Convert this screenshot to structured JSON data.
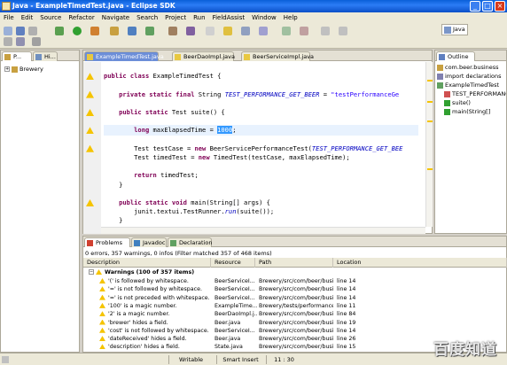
{
  "window": {
    "title": "Java - ExampleTimedTest.java - Eclipse SDK"
  },
  "menu": [
    "File",
    "Edit",
    "Source",
    "Refactor",
    "Navigate",
    "Search",
    "Project",
    "Run",
    "FieldAssist",
    "Window",
    "Help"
  ],
  "perspective": {
    "label": "Java"
  },
  "left_panel": {
    "tabs": [
      "P...",
      "Hi..."
    ],
    "tree": [
      {
        "label": "Brewery"
      }
    ]
  },
  "editor": {
    "tabs": [
      "ExampleTimedTest.java",
      "BeerDaoImpl.java",
      "BeerServiceImpl.java"
    ],
    "lines": [
      {
        "highlight": false,
        "warn": false,
        "html_parts": [
          {
            "t": "",
            "c": ""
          }
        ]
      },
      {
        "highlight": false,
        "warn": true,
        "parts": [
          {
            "t": "public ",
            "c": "kw"
          },
          {
            "t": "class ",
            "c": "kw"
          },
          {
            "t": "ExampleTimedTest {",
            "c": ""
          }
        ]
      },
      {
        "highlight": false,
        "warn": false,
        "parts": []
      },
      {
        "highlight": false,
        "warn": true,
        "parts": [
          {
            "t": "    private static final ",
            "c": "kw"
          },
          {
            "t": "String ",
            "c": ""
          },
          {
            "t": "TEST_PERFORMANCE_GET_BEER",
            "c": "fld"
          },
          {
            "t": " = ",
            "c": ""
          },
          {
            "t": "\"testPerformanceGe",
            "c": "str"
          }
        ]
      },
      {
        "highlight": false,
        "warn": false,
        "parts": []
      },
      {
        "highlight": false,
        "warn": true,
        "parts": [
          {
            "t": "    public static ",
            "c": "kw"
          },
          {
            "t": "Test suite() {",
            "c": ""
          }
        ]
      },
      {
        "highlight": false,
        "warn": false,
        "parts": []
      },
      {
        "highlight": true,
        "warn": true,
        "parts": [
          {
            "t": "        long ",
            "c": "kw"
          },
          {
            "t": "maxElapsedTime = ",
            "c": ""
          },
          {
            "t": "1000",
            "c": "sel"
          },
          {
            "t": ";",
            "c": ""
          }
        ]
      },
      {
        "highlight": false,
        "warn": false,
        "parts": []
      },
      {
        "highlight": false,
        "warn": true,
        "parts": [
          {
            "t": "        Test testCase = ",
            "c": ""
          },
          {
            "t": "new ",
            "c": "kw"
          },
          {
            "t": "BeerServicePerformanceTest(",
            "c": ""
          },
          {
            "t": "TEST_PERFORMANCE_GET_BEE",
            "c": "fld"
          }
        ]
      },
      {
        "highlight": false,
        "warn": false,
        "parts": [
          {
            "t": "        Test timedTest = ",
            "c": ""
          },
          {
            "t": "new ",
            "c": "kw"
          },
          {
            "t": "TimedTest(testCase, maxElapsedTime);",
            "c": ""
          }
        ]
      },
      {
        "highlight": false,
        "warn": false,
        "parts": []
      },
      {
        "highlight": false,
        "warn": false,
        "parts": [
          {
            "t": "        return ",
            "c": "kw"
          },
          {
            "t": "timedTest;",
            "c": ""
          }
        ]
      },
      {
        "highlight": false,
        "warn": false,
        "parts": [
          {
            "t": "    }",
            "c": ""
          }
        ]
      },
      {
        "highlight": false,
        "warn": false,
        "parts": []
      },
      {
        "highlight": false,
        "warn": true,
        "parts": [
          {
            "t": "    public static void ",
            "c": "kw"
          },
          {
            "t": "main(String[] args) {",
            "c": ""
          }
        ]
      },
      {
        "highlight": false,
        "warn": false,
        "parts": [
          {
            "t": "        junit.textui.TestRunner.",
            "c": ""
          },
          {
            "t": "run",
            "c": "fld"
          },
          {
            "t": "(suite());",
            "c": ""
          }
        ]
      },
      {
        "highlight": false,
        "warn": false,
        "parts": [
          {
            "t": "    }",
            "c": ""
          }
        ]
      },
      {
        "highlight": false,
        "warn": false,
        "parts": [
          {
            "t": "}",
            "c": ""
          }
        ]
      }
    ]
  },
  "outline": {
    "tab": "Outline",
    "items": [
      {
        "label": "com.beer.business",
        "indent": 0
      },
      {
        "label": "import declarations",
        "indent": 0
      },
      {
        "label": "ExampleTimedTest",
        "indent": 0
      },
      {
        "label": "TEST_PERFORMANCE",
        "indent": 1
      },
      {
        "label": "suite()",
        "indent": 1
      },
      {
        "label": "main(String[]",
        "indent": 1
      }
    ]
  },
  "problems": {
    "tabs": [
      "Problems",
      "Javadoc",
      "Declaration"
    ],
    "summary": "0 errors, 357 warnings, 0 infos (Filter matched 357 of 468 items)",
    "columns": [
      "Description",
      "Resource",
      "Path",
      "Location"
    ],
    "group": "Warnings (100 of 357 items)",
    "rows": [
      {
        "description": "'(' is followed by whitespace.",
        "resource": "BeerServiceI...",
        "path": "Brewery/src/com/beer/busin",
        "location": "line 14"
      },
      {
        "description": "'=' is not followed by whitespace.",
        "resource": "BeerServiceI...",
        "path": "Brewery/src/com/beer/busin",
        "location": "line 14"
      },
      {
        "description": "'=' is not preceded with whitespace.",
        "resource": "BeerServiceI...",
        "path": "Brewery/src/com/beer/busin",
        "location": "line 14"
      },
      {
        "description": "'100' is a magic number.",
        "resource": "ExampleTime...",
        "path": "Brewery/tests/performance/",
        "location": "line 11"
      },
      {
        "description": "'2' is a magic number.",
        "resource": "BeerDaoImpl.j...",
        "path": "Brewery/src/com/beer/busin",
        "location": "line 84"
      },
      {
        "description": "'brewer' hides a field.",
        "resource": "Beer.java",
        "path": "Brewery/src/com/beer/busin",
        "location": "line 19"
      },
      {
        "description": "'cost' is not followed by whitespace.",
        "resource": "BeerServiceI...",
        "path": "Brewery/src/com/beer/busin",
        "location": "line 14"
      },
      {
        "description": "'dateReceived' hides a field.",
        "resource": "Beer.java",
        "path": "Brewery/src/com/beer/busin",
        "location": "line 26"
      },
      {
        "description": "'description' hides a field.",
        "resource": "State.java",
        "path": "Brewery/src/com/beer/busin",
        "location": "line 15"
      }
    ]
  },
  "status": {
    "writable": "Writable",
    "insert": "Smart Insert",
    "position": "11 : 30"
  },
  "watermark": "百度知道"
}
